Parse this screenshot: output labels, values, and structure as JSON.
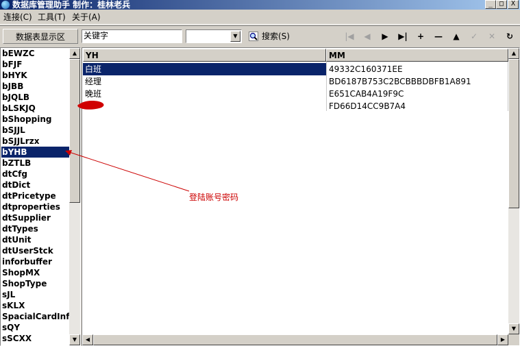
{
  "window": {
    "title": "数据库管理助手  制作：桂林老兵",
    "buttons": {
      "minimize": "_",
      "maximize": "□",
      "close": "X"
    }
  },
  "menu": {
    "items": [
      "连接(C)",
      "工具(T)",
      "关于(A)"
    ]
  },
  "toolbar": {
    "area_label": "数据表显示区",
    "keyword_value": "关键字",
    "field_select_value": "",
    "search_label": "搜索(S)",
    "nav_buttons": [
      {
        "name": "first-record",
        "glyph": "|◀",
        "enabled": false
      },
      {
        "name": "prior-record",
        "glyph": "◀",
        "enabled": false
      },
      {
        "name": "next-record",
        "glyph": "▶",
        "enabled": true
      },
      {
        "name": "last-record",
        "glyph": "▶|",
        "enabled": true
      },
      {
        "name": "insert-record",
        "glyph": "+",
        "enabled": true
      },
      {
        "name": "delete-record",
        "glyph": "—",
        "enabled": true
      },
      {
        "name": "edit-record",
        "glyph": "▲",
        "enabled": true
      },
      {
        "name": "post-record",
        "glyph": "✓",
        "enabled": false
      },
      {
        "name": "cancel-edit",
        "glyph": "✕",
        "enabled": false
      },
      {
        "name": "refresh-data",
        "glyph": "↻",
        "enabled": true
      }
    ]
  },
  "table_list": {
    "items": [
      "bEWZC",
      "bFJF",
      "bHYK",
      "bJBB",
      "bJQLB",
      "bLSKJQ",
      "bShopping",
      "bSJJL",
      "bSJJLrzx",
      "bYHB",
      "bZTLB",
      "dtCfg",
      "dtDict",
      "dtPricetype",
      "dtproperties",
      "dtSupplier",
      "dtTypes",
      "dtUnit",
      "dtUserStck",
      "inforbuffer",
      "ShopMX",
      "ShopType",
      "sJL",
      "sKLX",
      "SpacialCardInfo",
      "sQY",
      "sSCXX"
    ],
    "selected_index": 9
  },
  "grid": {
    "columns": [
      "YH",
      "MM"
    ],
    "rows": [
      [
        "白班",
        "49332C160371EE"
      ],
      [
        "经理",
        "BD6187B753C2BCBBBDBFB1A891"
      ],
      [
        "晚班",
        "E651CAB4A19F9C"
      ],
      [
        "",
        "FD66D14CC9B7A4"
      ]
    ],
    "selected_row": 0
  },
  "annotation": {
    "text": "登陆账号密码",
    "color": "#cc0000"
  },
  "colors": {
    "selection": "#0a246a",
    "face": "#d4d0c8"
  }
}
